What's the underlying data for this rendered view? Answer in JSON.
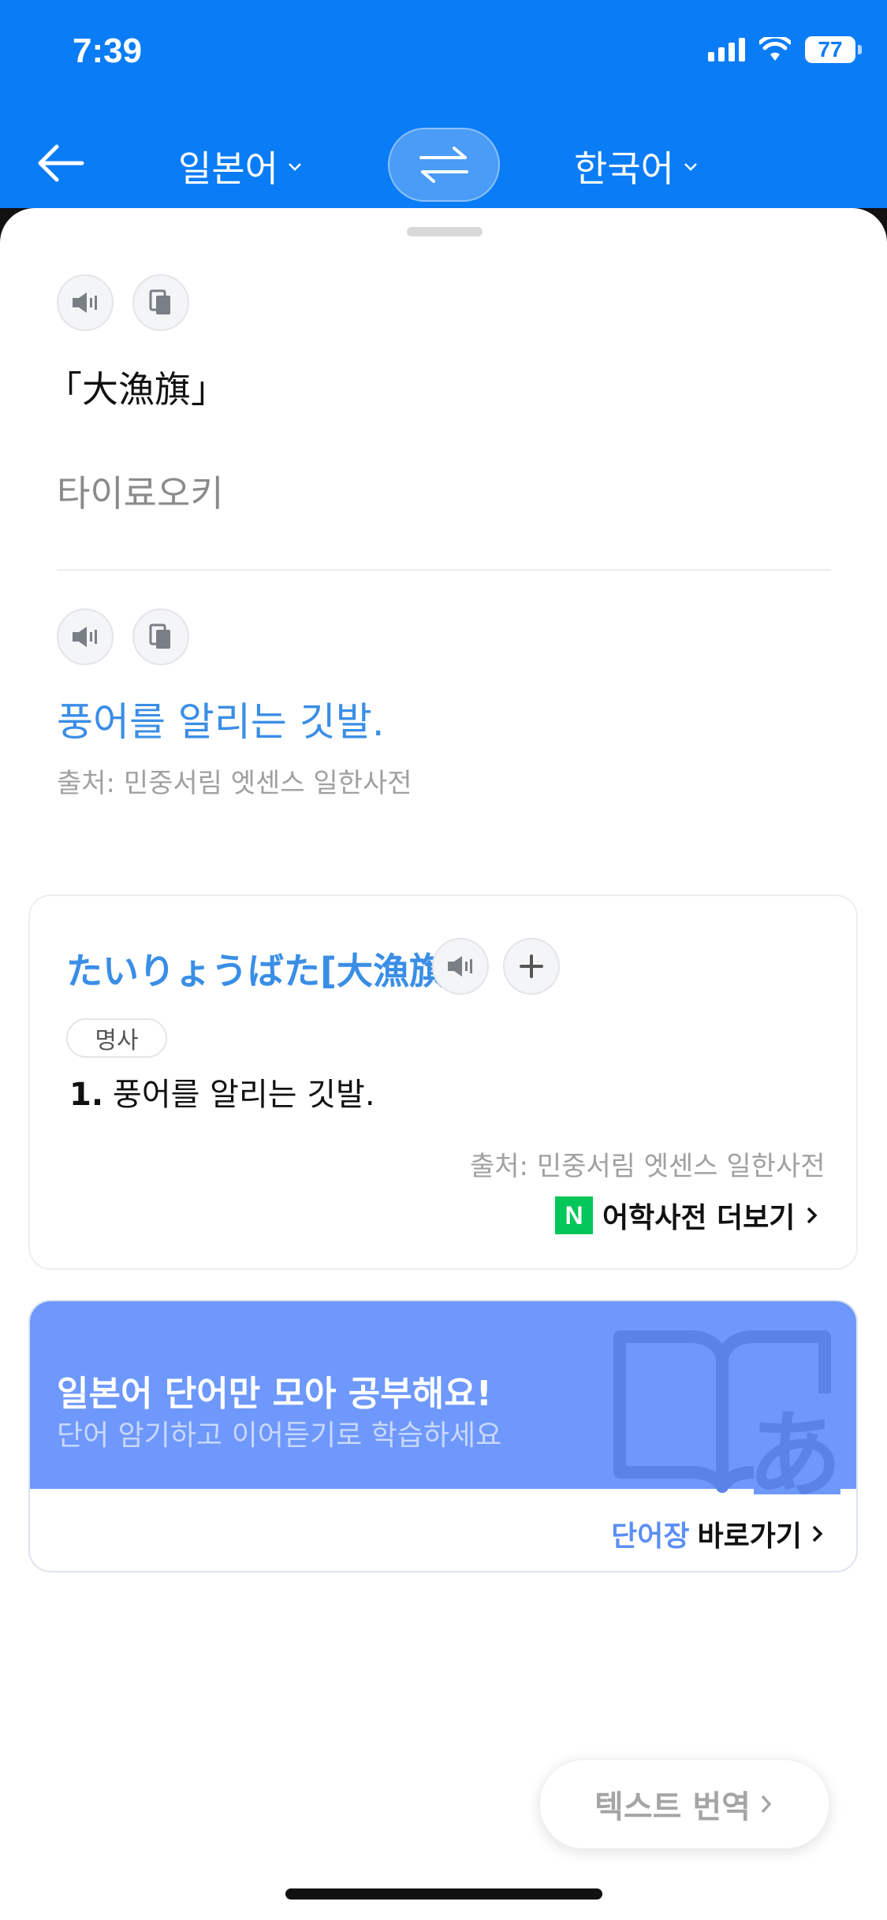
{
  "status_bar": {
    "time": "7:39",
    "battery": "77"
  },
  "nav": {
    "source_lang": "일본어",
    "target_lang": "한국어"
  },
  "source": {
    "text": "「大漁旗」",
    "reading": "타이료오키"
  },
  "result": {
    "translation": "풍어를 알리는 깃발.",
    "source_label": "출처: 민중서림 엣센스 일한사전"
  },
  "dictionary": {
    "headword": "たいりょうばた[大漁旗]",
    "part_of_speech": "명사",
    "definition_number": "1.",
    "definition": "풍어를 알리는 깃발.",
    "source_label": "출처: 민중서림 엣센스 일한사전",
    "logo_letter": "N",
    "more_label": "어학사전 더보기"
  },
  "promo": {
    "title": "일본어 단어만 모아 공부해요!",
    "subtitle": "단어 암기하고 이어듣기로 학습하세요",
    "art_glyph": "あ",
    "link_accent": "단어장",
    "link_label": "바로가기"
  },
  "floating": {
    "text_translate": "텍스트 번역"
  },
  "colors": {
    "header_blue": "#0a7cf5",
    "accent_blue": "#3a8ee6",
    "promo_blue": "#6e98fb",
    "naver_green": "#03c75a"
  }
}
